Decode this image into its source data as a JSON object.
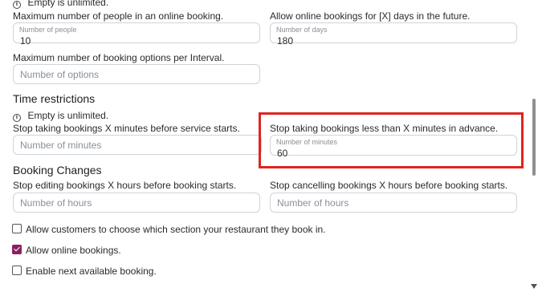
{
  "top_note": "Empty is unlimited.",
  "online": {
    "max_people_label": "Maximum number of people in an online booking.",
    "max_people_field": {
      "label": "Number of people",
      "value": "10"
    },
    "days_future_label": "Allow online bookings for [X] days in the future.",
    "days_future_field": {
      "label": "Number of days",
      "value": "180"
    },
    "max_options_label": "Maximum number of booking options per Interval.",
    "max_options_placeholder": "Number of options"
  },
  "time_restrictions": {
    "heading": "Time restrictions",
    "note": "Empty is unlimited.",
    "stop_before_start_label": "Stop taking bookings X minutes before service starts.",
    "stop_before_start_placeholder": "Number of minutes",
    "stop_advance_label": "Stop taking bookings less than X minutes in advance.",
    "stop_advance_field": {
      "label": "Number of minutes",
      "value": "60"
    }
  },
  "booking_changes": {
    "heading": "Booking Changes",
    "stop_editing_label": "Stop editing bookings X hours before booking starts.",
    "stop_editing_placeholder": "Number of hours",
    "stop_cancelling_label": "Stop cancelling bookings X hours before booking starts.",
    "stop_cancelling_placeholder": "Number of hours"
  },
  "checkboxes": [
    {
      "label": "Allow customers to choose which section your restaurant they book in.",
      "checked": false
    },
    {
      "label": "Allow online bookings.",
      "checked": true
    },
    {
      "label": "Enable next available booking.",
      "checked": false
    }
  ],
  "colors": {
    "accent": "#8b2161",
    "highlight": "#e0231f"
  }
}
